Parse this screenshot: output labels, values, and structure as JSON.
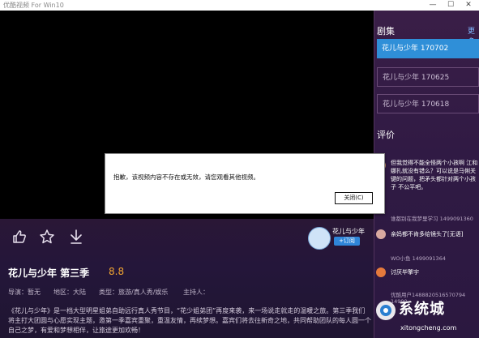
{
  "window": {
    "title": "优酷视频 For Win10",
    "controls": [
      "—",
      "☐",
      "✕"
    ]
  },
  "player": {
    "action_icons": [
      "thumbs-up-icon",
      "star-icon",
      "download-icon"
    ]
  },
  "uploader": {
    "name": "花儿与少年",
    "subscribe_label": "+订阅"
  },
  "show": {
    "title": "花儿与少年 第三季",
    "rating": "8.8",
    "director": "导演：暂无",
    "region": "地区：大陆",
    "genre": "类型：旅游/真人秀/娱乐",
    "host": "主持人：",
    "description": "《花儿与少年》是一档大型明星姐弟自助远行真人秀节目，“花少姐弟团”再度来袭，来一场说走就走的温暖之旅。第三季我们将主打大团圆与心愿实现主题，邀第一季嘉宾重聚，重温友情，再续梦想。嘉宾们将去往新奇之地，共同帮助团队的每人圆一个自己之梦，有爱和梦想相伴，让旅途更加欢畅！"
  },
  "episodes": {
    "header": "剧集",
    "more_label": "更多",
    "items": [
      {
        "label": "花儿与少年 170702",
        "active": true
      },
      {
        "label": "花儿与少年 170625",
        "active": false
      },
      {
        "label": "花儿与少年 170618",
        "active": false
      }
    ]
  },
  "comments": {
    "header": "评价",
    "items": [
      {
        "text": "但我觉得不能全怪两个小孩啊 江和娜扎就没有错么？可以说是马俐关键的问题，把矛头都针对两个小孩子 不公平吧。",
        "meta": "谁都别在我梦里学习    1499091360"
      },
      {
        "text": "亲妈都不肯多给镜头了[无语]",
        "meta": "WO小鱼    1499091364"
      },
      {
        "text": "讨厌毕擎宇",
        "meta": "优酷用户1488820516570794    14990"
      }
    ]
  },
  "dialog": {
    "message": "抱歉，该视频内容不存在或无效，请您观看其他视频。",
    "close_label": "关闭(C)"
  },
  "watermark": {
    "main": "系统城",
    "sub": "xitongcheng.com"
  },
  "colors": {
    "accent": "#2f8fd8",
    "rating": "#f2a531",
    "background": "#1a0f24"
  }
}
